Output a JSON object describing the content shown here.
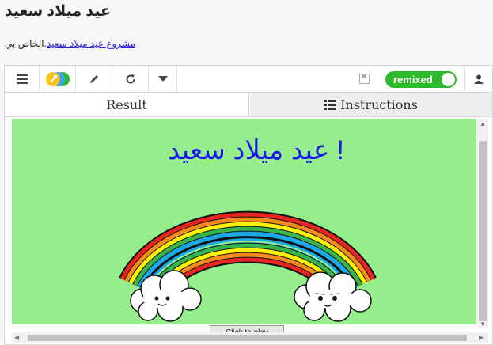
{
  "page": {
    "title": "عيد ميلاد سعيد",
    "attribution_prefix": ".الخاص بي ",
    "attribution_link": "مشروع عيد ميلاد سعيد"
  },
  "toolbar": {
    "menu_icon": "menu-icon",
    "pencil_icon": "pencil-icon",
    "reload_icon": "reload-icon",
    "dropdown_icon": "caret-down-icon",
    "save_icon": "save-icon",
    "remixed_label": "remixed",
    "user_icon": "user-icon"
  },
  "tabs": {
    "result": "Result",
    "instructions": "Instructions"
  },
  "stage": {
    "greeting": "! عيد ميلاد سعيد",
    "button_label": "Click to play"
  },
  "colors": {
    "stage_bg": "#95ed8c",
    "greeting": "#1a1ae6",
    "toggle": "#2eb82e",
    "link": "#2b2bd8"
  }
}
